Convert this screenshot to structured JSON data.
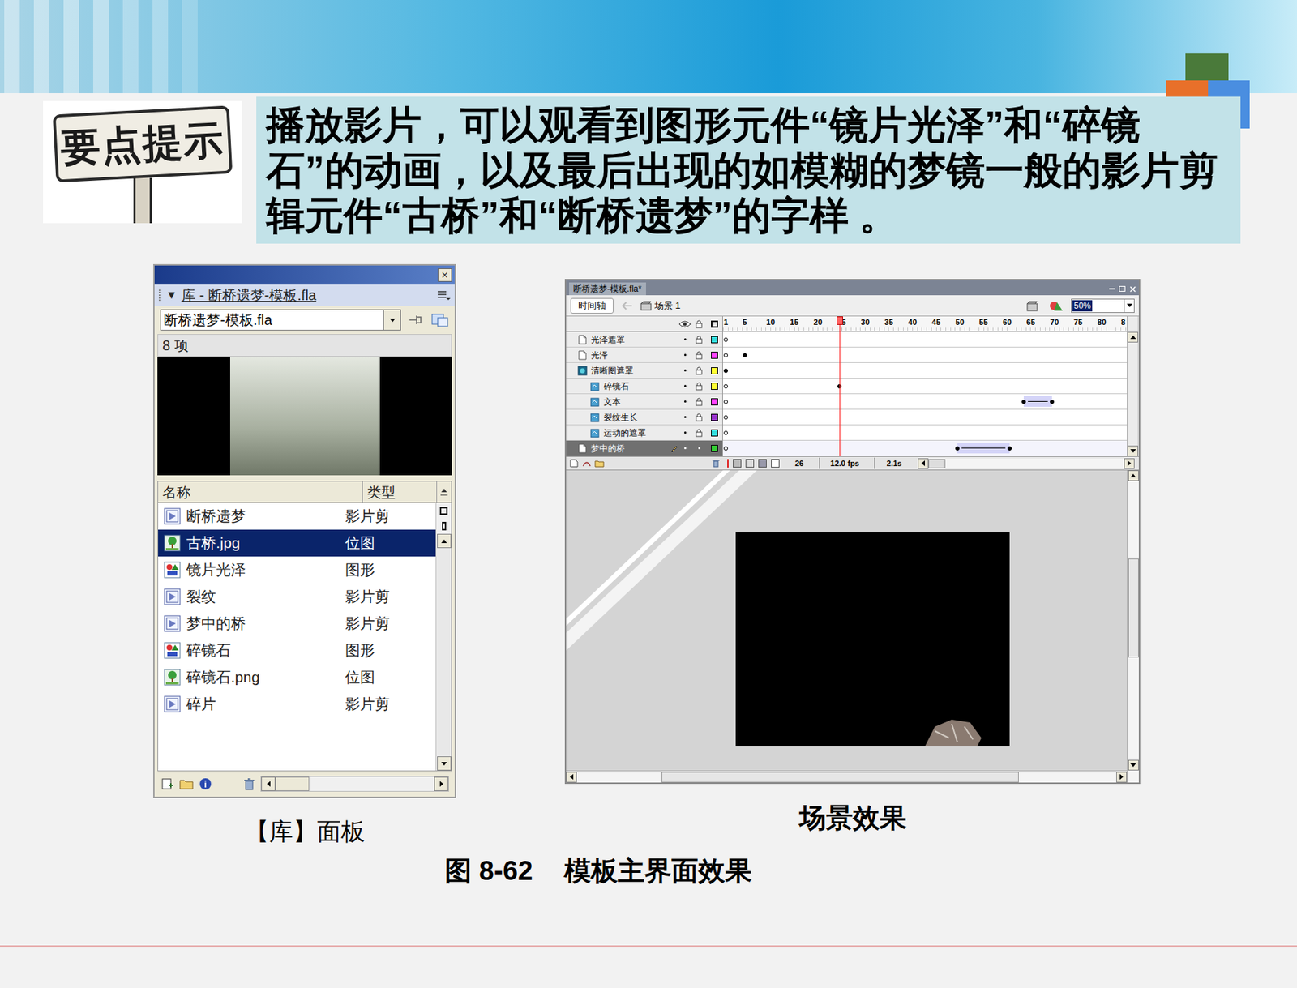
{
  "slide": {
    "sign": "要点提示",
    "tip": "播放影片，可以观看到图形元件“镜片光泽”和“碎镜石”的动画，以及最后出现的如模糊的梦镜一般的影片剪辑元件“古桥”和“断桥遗梦”的字样 。"
  },
  "library": {
    "close": "×",
    "header_arrow": "▼",
    "title": "库 - 断桥遗梦-模板.fla",
    "document": "断桥遗梦-模板.fla",
    "count": "8 项",
    "columns": [
      "名称",
      "类型"
    ],
    "items": [
      {
        "name": "断桥遗梦",
        "type": "影片剪",
        "kind": "movieclip",
        "selected": false
      },
      {
        "name": "古桥.jpg",
        "type": "位图",
        "kind": "bitmap",
        "selected": true
      },
      {
        "name": "镜片光泽",
        "type": "图形",
        "kind": "graphic",
        "selected": false
      },
      {
        "name": "裂纹",
        "type": "影片剪",
        "kind": "movieclip",
        "selected": false
      },
      {
        "name": "梦中的桥",
        "type": "影片剪",
        "kind": "movieclip",
        "selected": false
      },
      {
        "name": "碎镜石",
        "type": "图形",
        "kind": "graphic",
        "selected": false
      },
      {
        "name": "碎镜石.png",
        "type": "位图",
        "kind": "bitmap",
        "selected": false
      },
      {
        "name": "碎片",
        "type": "影片剪",
        "kind": "movieclip",
        "selected": false
      }
    ]
  },
  "timeline": {
    "title": "断桥遗梦-模板.fla*",
    "tab": "时间轴",
    "scene": "场景 1",
    "zoom": "50%",
    "ticks": [
      {
        "frame": 1,
        "label": "1"
      },
      {
        "frame": 5,
        "label": "5"
      },
      {
        "frame": 10,
        "label": "10"
      },
      {
        "frame": 15,
        "label": "15"
      },
      {
        "frame": 20,
        "label": "20"
      },
      {
        "frame": 25,
        "label": "25"
      },
      {
        "frame": 30,
        "label": "30"
      },
      {
        "frame": 35,
        "label": "35"
      },
      {
        "frame": 40,
        "label": "40"
      },
      {
        "frame": 45,
        "label": "45"
      },
      {
        "frame": 50,
        "label": "50"
      },
      {
        "frame": 55,
        "label": "55"
      },
      {
        "frame": 60,
        "label": "60"
      },
      {
        "frame": 65,
        "label": "65"
      },
      {
        "frame": 70,
        "label": "70"
      },
      {
        "frame": 75,
        "label": "75"
      },
      {
        "frame": 80,
        "label": "80"
      },
      {
        "frame": 85,
        "label": "8"
      }
    ],
    "playhead_frame": 25,
    "layers": [
      {
        "name": "光泽遮罩",
        "kind": "normal",
        "color": "#33dddd",
        "selected": false,
        "locked": true,
        "keyframes": [
          {
            "frame": 1,
            "filled": false
          }
        ],
        "tween": null
      },
      {
        "name": "光泽",
        "kind": "normal",
        "color": "#ff44ff",
        "selected": false,
        "locked": true,
        "keyframes": [
          {
            "frame": 1,
            "filled": false
          },
          {
            "frame": 5,
            "filled": true
          }
        ],
        "tween": null
      },
      {
        "name": "清晰图遮罩",
        "kind": "mask",
        "color": "#ffff33",
        "selected": false,
        "locked": true,
        "keyframes": [
          {
            "frame": 1,
            "filled": true
          }
        ],
        "tween": null
      },
      {
        "name": "碎镜石",
        "kind": "masked",
        "color": "#ffff33",
        "selected": false,
        "locked": true,
        "keyframes": [
          {
            "frame": 1,
            "filled": false
          },
          {
            "frame": 25,
            "filled": true
          }
        ],
        "tween": null
      },
      {
        "name": "文本",
        "kind": "masked",
        "color": "#ff44ff",
        "selected": false,
        "locked": true,
        "keyframes": [
          {
            "frame": 1,
            "filled": false
          },
          {
            "frame": 64,
            "filled": true
          },
          {
            "frame": 70,
            "filled": true
          }
        ],
        "tween": [
          64,
          70
        ]
      },
      {
        "name": "裂纹生长",
        "kind": "masked",
        "color": "#9933cc",
        "selected": false,
        "locked": true,
        "keyframes": [
          {
            "frame": 1,
            "filled": false
          }
        ],
        "tween": null
      },
      {
        "name": "运动的遮罩",
        "kind": "masked",
        "color": "#33dddd",
        "selected": false,
        "locked": true,
        "keyframes": [
          {
            "frame": 1,
            "filled": false
          }
        ],
        "tween": null
      },
      {
        "name": "梦中的桥",
        "kind": "normal",
        "color": "#33cc33",
        "selected": true,
        "locked": false,
        "keyframes": [
          {
            "frame": 1,
            "filled": false
          },
          {
            "frame": 50,
            "filled": true
          },
          {
            "frame": 61,
            "filled": true
          }
        ],
        "tween": [
          50,
          61
        ]
      }
    ],
    "status": {
      "frame": "26",
      "fps": "12.0 fps",
      "time": "2.1s"
    }
  },
  "captions": {
    "library": "【库】面板",
    "scene": "场景效果",
    "figure_number": "图 8-62",
    "figure_title": "模板主界面效果"
  }
}
